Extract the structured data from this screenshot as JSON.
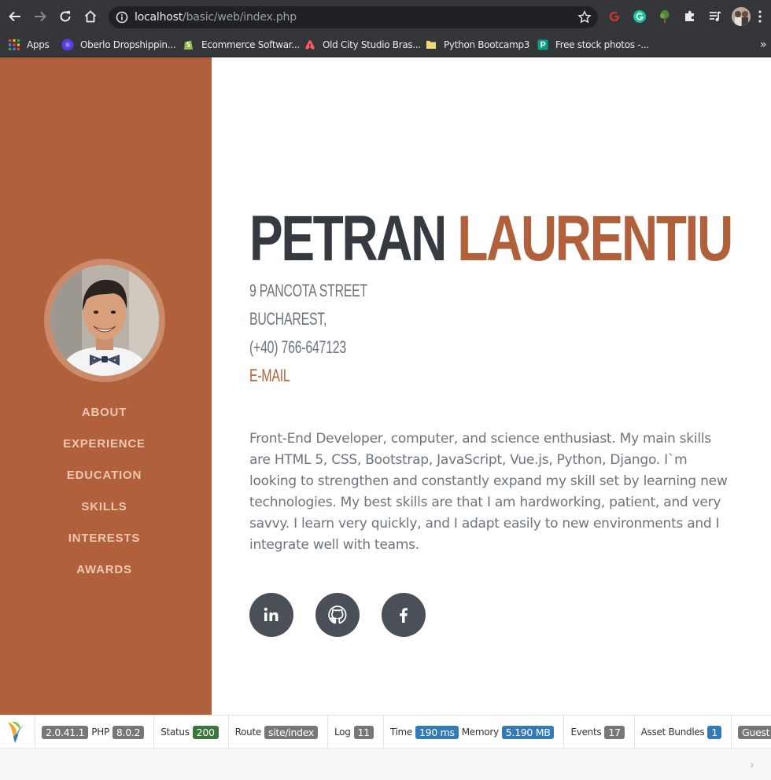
{
  "browser": {
    "url_host": "localhost",
    "url_path": "/basic/web/index.php",
    "bookmarks": [
      {
        "label": "Apps"
      },
      {
        "label": "Oberlo Dropshippin..."
      },
      {
        "label": "Ecommerce Softwar..."
      },
      {
        "label": "Old City Studio Bras..."
      },
      {
        "label": "Python Bootcamp3"
      },
      {
        "label": "Free stock photos -..."
      }
    ],
    "more": "»"
  },
  "sidebar": {
    "nav": [
      {
        "label": "ABOUT"
      },
      {
        "label": "EXPERIENCE"
      },
      {
        "label": "EDUCATION"
      },
      {
        "label": "SKILLS"
      },
      {
        "label": "INTERESTS"
      },
      {
        "label": "AWARDS"
      }
    ]
  },
  "profile": {
    "first_name": "PETRAN",
    "last_name": "LAURENTIU",
    "street": "9 PANCOTA STREET",
    "city": "BUCHAREST,",
    "phone": "(+40) 766-647123",
    "email_label": "E-MAIL",
    "about": "Front-End Developer, computer, and science enthusiast. My main skills are HTML 5, CSS, Bootstrap, JavaScript, Vue.js, Python, Django. I`m looking to strengthen and constantly expand my skill set by learning new technologies. My best skills are that I am hardworking, patient, and very savvy. I learn very quickly, and I adapt easily to new environments and I integrate well with teams.",
    "socials": [
      "linkedin-icon",
      "github-icon",
      "facebook-icon"
    ]
  },
  "debug_toolbar": {
    "yii_version": "2.0.41.1",
    "php_label": "PHP",
    "php_version": "8.0.2",
    "status_label": "Status",
    "status_code": "200",
    "route_label": "Route",
    "route": "site/index",
    "log_label": "Log",
    "log_count": "11",
    "time_label": "Time",
    "time": "190 ms",
    "memory_label": "Memory",
    "memory": "5.190 MB",
    "events_label": "Events",
    "events_count": "17",
    "assets_label": "Asset Bundles",
    "assets_count": "1",
    "user": "Guest",
    "collapse": "›"
  },
  "colors": {
    "accent": "#b0613b",
    "dark": "#343a40",
    "muted": "#6c757d"
  }
}
